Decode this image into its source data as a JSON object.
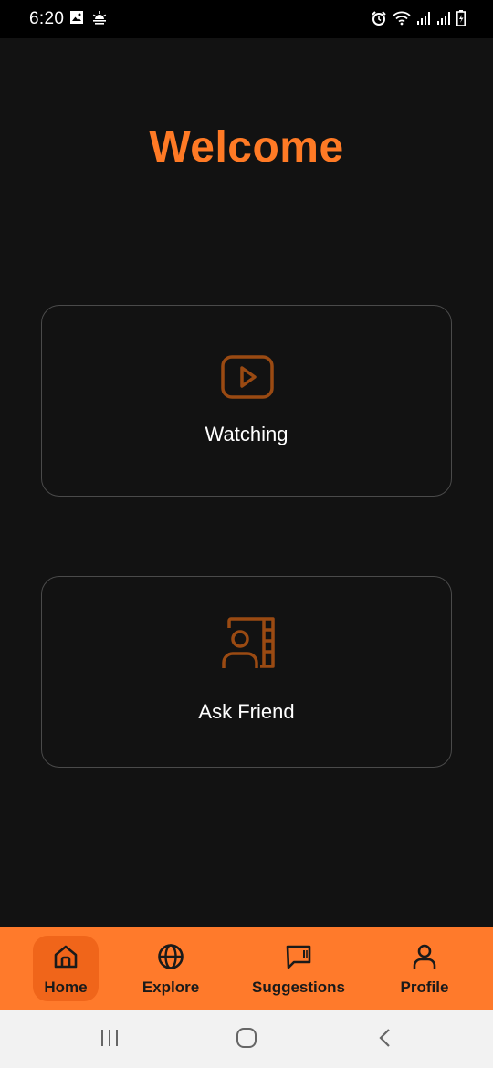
{
  "status_bar": {
    "time": "6:20",
    "left_icons": [
      "image-icon",
      "weather-icon"
    ],
    "right_icons": [
      "alarm-icon",
      "wifi-icon",
      "signal-icon",
      "signal-icon",
      "battery-icon"
    ]
  },
  "main": {
    "title": "Welcome",
    "cards": [
      {
        "label": "Watching",
        "icon": "play-icon"
      },
      {
        "label": "Ask Friend",
        "icon": "contacts-icon"
      }
    ]
  },
  "bottom_nav": {
    "items": [
      {
        "label": "Home",
        "icon": "home-icon",
        "active": true
      },
      {
        "label": "Explore",
        "icon": "globe-icon",
        "active": false
      },
      {
        "label": "Suggestions",
        "icon": "message-icon",
        "active": false
      },
      {
        "label": "Profile",
        "icon": "user-icon",
        "active": false
      }
    ]
  },
  "system_nav": {
    "buttons": [
      "recents-icon",
      "home-circle-icon",
      "back-icon"
    ]
  },
  "colors": {
    "accent": "#ff7a25",
    "nav_background": "#ff7a2b",
    "nav_active": "#f0651a",
    "background": "#121212",
    "card_border": "#4a4a4a",
    "icon_brown": "#9a4a12"
  }
}
